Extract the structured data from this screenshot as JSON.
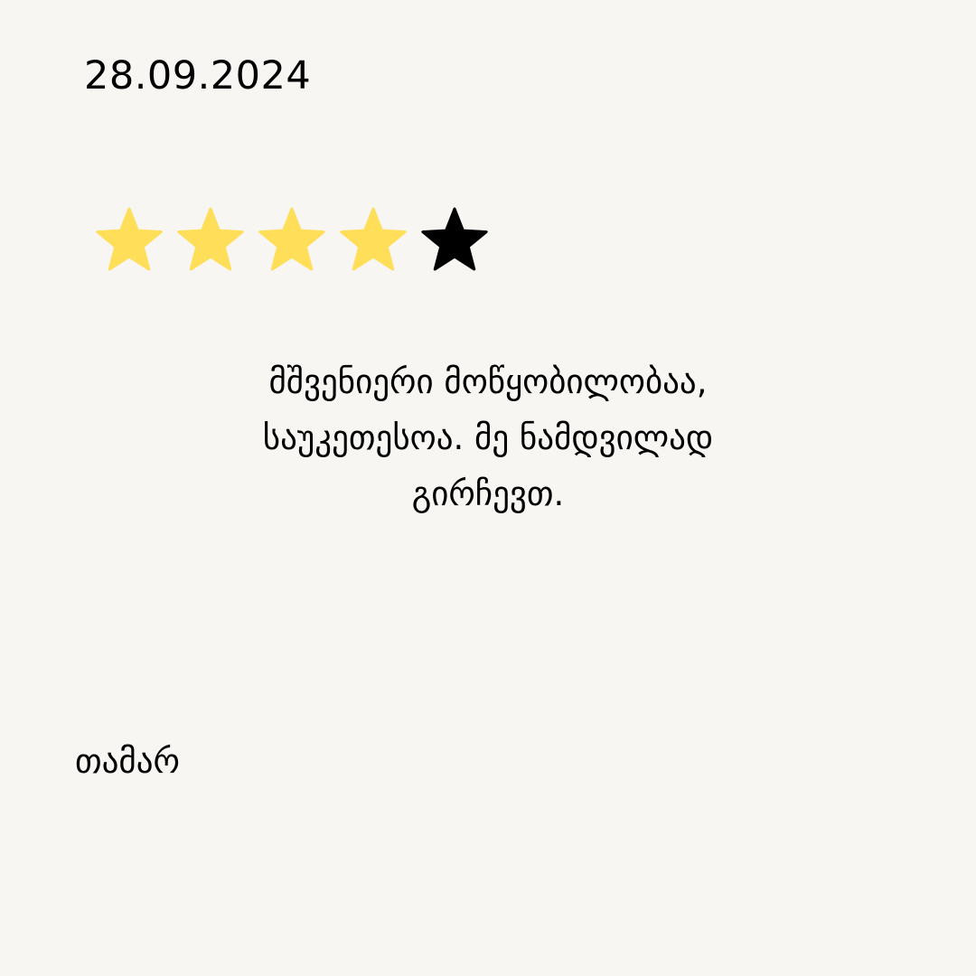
{
  "review_card": {
    "date": "28.09.2024",
    "rating": {
      "value": 4,
      "max": 5,
      "filled_color": "#ffde59",
      "empty_color": "#000000",
      "filled_icon": "star-filled-icon",
      "empty_icon": "star-empty-icon"
    },
    "review_lines": [
      "მშვენიერი მოწყობილობაა,",
      "საუკეთესოა. მე ნამდვილად",
      "გირჩევთ."
    ],
    "author": "თამარ"
  }
}
